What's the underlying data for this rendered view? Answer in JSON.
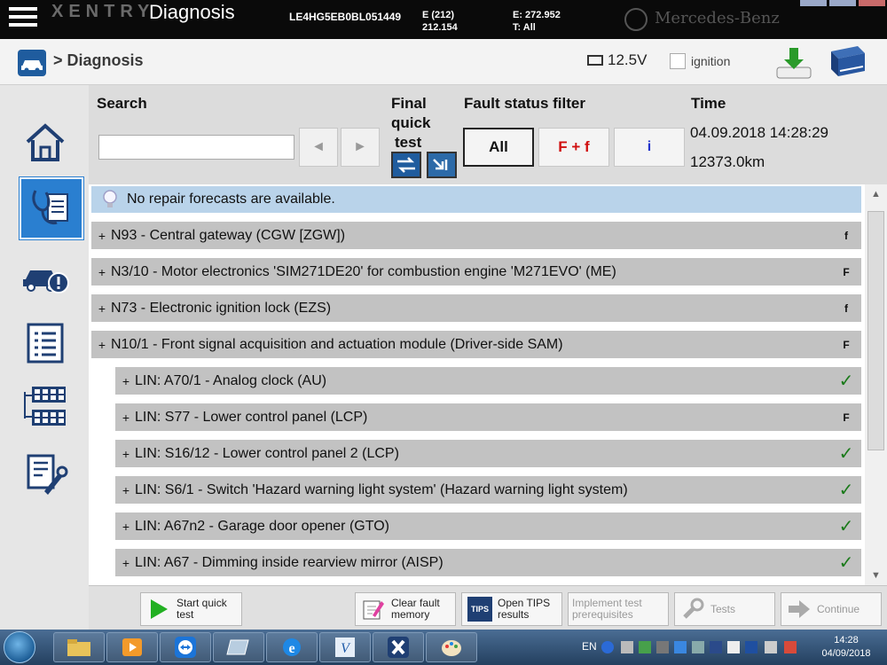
{
  "app": {
    "brand": "XENTRY",
    "title": "Diagnosis",
    "vin": "LE4HG5EB0BL051449",
    "vehicle_e": "E (212)",
    "vehicle_code": "212.154",
    "engine_e": "E: 272.952",
    "transmission": "T: All",
    "brand_name": "Mercedes-Benz"
  },
  "breadcrumb": {
    "text": "> Diagnosis",
    "voltage": "12.5V",
    "ignition_label": "ignition"
  },
  "header": {
    "search_label": "Search",
    "search_value": "",
    "prev_symbol": "◄",
    "next_symbol": "►",
    "final_quick_test_label": [
      "Final",
      "quick",
      "test"
    ],
    "fault_filter_label": "Fault status filter",
    "filters": [
      "All",
      "F + f",
      "i"
    ],
    "time_label": "Time",
    "datetime": "04.09.2018 14:28:29",
    "mileage": "12373.0km"
  },
  "forecast_text": "No repair forecasts are available.",
  "rows": [
    {
      "label": "N93 - Central gateway (CGW [ZGW])",
      "status": "f",
      "indent": 0
    },
    {
      "label": "N3/10 - Motor electronics 'SIM271DE20' for combustion engine 'M271EVO' (ME)",
      "status": "F",
      "indent": 0
    },
    {
      "label": "N73 - Electronic ignition lock (EZS)",
      "status": "f",
      "indent": 0
    },
    {
      "label": "N10/1 - Front signal acquisition and actuation module (Driver-side SAM)",
      "status": "F",
      "indent": 0
    },
    {
      "label": "LIN: A70/1 - Analog clock (AU)",
      "status": "✓",
      "indent": 1
    },
    {
      "label": "LIN: S77 - Lower control panel (LCP)",
      "status": "F",
      "indent": 1
    },
    {
      "label": "LIN: S16/12 - Lower control panel 2 (LCP)",
      "status": "✓",
      "indent": 1
    },
    {
      "label": "LIN: S6/1 - Switch 'Hazard warning light system' (Hazard warning light system)",
      "status": "✓",
      "indent": 1
    },
    {
      "label": "LIN: A67n2 - Garage door opener (GTO)",
      "status": "✓",
      "indent": 1
    },
    {
      "label": "LIN: A67 - Dimming inside rearview mirror (AISP)",
      "status": "✓",
      "indent": 1
    }
  ],
  "plus_symbol": "+",
  "toolbar": {
    "start_quick_test": [
      "Start quick",
      "test"
    ],
    "clear_fault_memory": [
      "Clear fault",
      "memory"
    ],
    "tips_badge": "TIPS",
    "open_tips": [
      "Open TIPS",
      "results"
    ],
    "implement_prereq": [
      "Implement test",
      "prerequisites"
    ],
    "tests": "Tests",
    "continue": "Continue"
  },
  "taskbar": {
    "lang": "EN",
    "time": "14:28",
    "date": "04/09/2018"
  },
  "colors": {
    "accent_blue": "#1f5c9e",
    "forecast_bg": "#b9d3ea",
    "row_bg": "#c2c2c2",
    "ok_green": "#1a7a1a",
    "filter_red": "#d01010",
    "filter_blue": "#2233cc"
  }
}
